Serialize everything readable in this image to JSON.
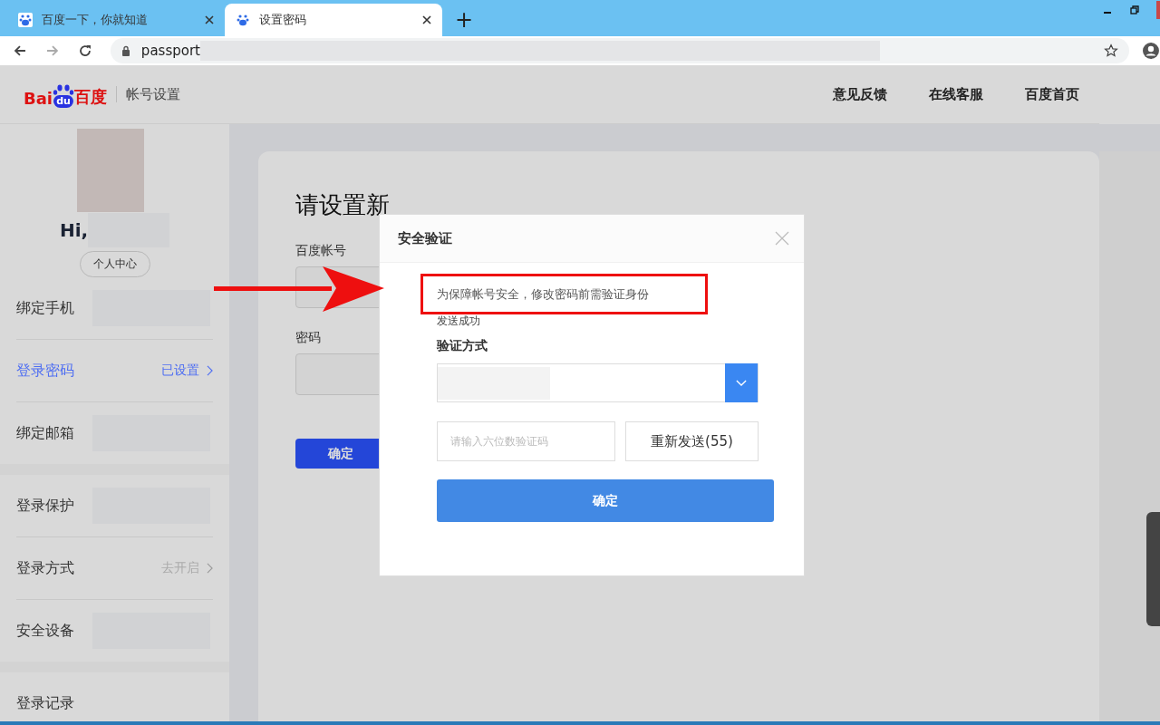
{
  "browser": {
    "tabs": [
      {
        "title": "百度一下，你就知道",
        "selected": false
      },
      {
        "title": "设置密码",
        "selected": true
      }
    ],
    "new_tab": "+",
    "url": "passport"
  },
  "header": {
    "logo": {
      "left": "Bai",
      "paw": "du",
      "right": "百度"
    },
    "section": "帐号设置",
    "links": [
      "意见反馈",
      "在线客服",
      "百度首页"
    ]
  },
  "profile": {
    "greeting": "Hi,",
    "button": "个人中心"
  },
  "sidebar": {
    "groups": [
      {
        "items": [
          {
            "label": "绑定手机",
            "selected": false,
            "redacted": true
          },
          {
            "label": "登录密码",
            "selected": true,
            "status": "已设置",
            "redacted": false
          },
          {
            "label": "绑定邮箱",
            "selected": false,
            "redacted": true
          }
        ]
      },
      {
        "items": [
          {
            "label": "登录保护",
            "selected": false,
            "redacted": true
          },
          {
            "label": "登录方式",
            "selected": false,
            "status": "去开启",
            "redacted": false
          },
          {
            "label": "安全设备",
            "selected": false,
            "redacted": true
          }
        ]
      },
      {
        "items": [
          {
            "label": "登录记录",
            "selected": false,
            "redacted": false
          }
        ]
      }
    ]
  },
  "form": {
    "title": "请设置新",
    "fields": [
      {
        "label": "百度帐号"
      },
      {
        "label": "密码"
      }
    ],
    "submit": "确定"
  },
  "dialog": {
    "title": "安全验证",
    "hint": "为保障帐号安全，修改密码前需验证身份",
    "sent_notice": "发送成功",
    "method_label": "验证方式",
    "code_placeholder": "请输入六位数验证码",
    "resend": "重新发送(55)",
    "confirm": "确定"
  }
}
